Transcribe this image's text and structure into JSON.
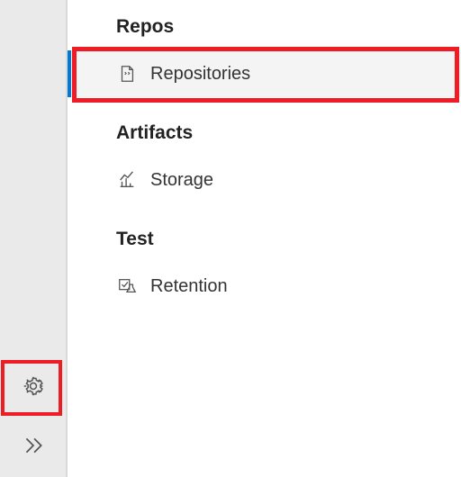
{
  "sections": {
    "repos": {
      "header": "Repos",
      "items": {
        "repositories": "Repositories"
      }
    },
    "artifacts": {
      "header": "Artifacts",
      "items": {
        "storage": "Storage"
      }
    },
    "test": {
      "header": "Test",
      "items": {
        "retention": "Retention"
      }
    }
  },
  "rail": {
    "settings": "Project settings",
    "expand": "Expand"
  }
}
